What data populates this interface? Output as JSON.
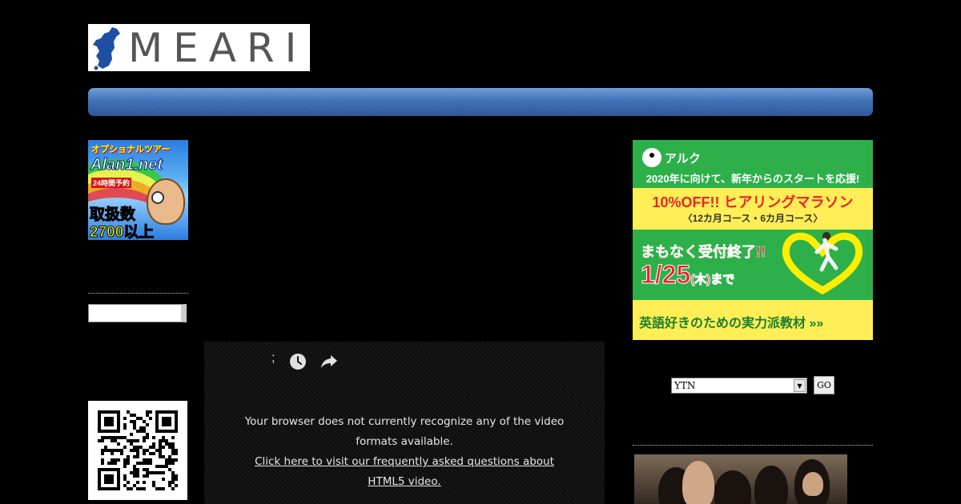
{
  "header": {
    "logo_text": "MEARI"
  },
  "left_ad": {
    "top_text": "オプショナルツアー",
    "brand": "Alan1.net",
    "sub": "24時間予約",
    "count_label": "取扱数",
    "count_value": "2700以上"
  },
  "left_search": {
    "value": ""
  },
  "video_player": {
    "tick": ";",
    "message": "Your browser does not currently recognize any of the video formats available.",
    "link_text": "Click here to visit our frequently asked questions about HTML5 video."
  },
  "right_ad": {
    "brand": "アルク",
    "line1": "2020年に向けて、新年からのスタートを応援!",
    "discount": "10%OFF!! ヒアリングマラソン",
    "course": "〈12カ月コース・6カ月コース〉",
    "soon": "まもなく受付終了!!",
    "date": "1/25",
    "date_suffix": "(木)まで",
    "bottom": "英語好きのための実力派教材 »»"
  },
  "channel_select": {
    "selected": "YTN",
    "go_label": "GO"
  },
  "colors": {
    "nav_blue": "#3e6fb6",
    "ad_green": "#2db04a",
    "ad_yellow": "#ffee55",
    "ad_red": "#e8262c"
  }
}
